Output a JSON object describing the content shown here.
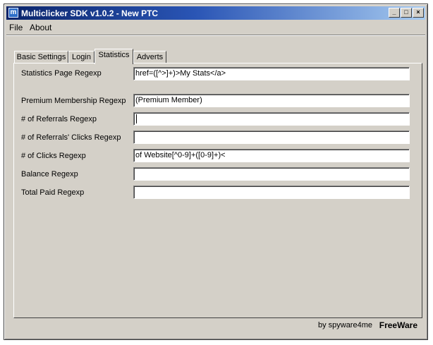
{
  "window": {
    "title": "Multiclicker SDK v1.0.2 - New PTC",
    "app_icon_letter": "m"
  },
  "menu": {
    "items": [
      "File",
      "About"
    ]
  },
  "tabs": [
    {
      "label": "Basic Settings",
      "active": false
    },
    {
      "label": "Login",
      "active": false
    },
    {
      "label": "Statistics",
      "active": true
    },
    {
      "label": "Adverts",
      "active": false
    }
  ],
  "fields": [
    {
      "label": "Statistics Page Regexp",
      "value": "href=([^>]+)>My Stats</a>"
    },
    {
      "label": "Premium Membership Regexp",
      "value": "(Premium Member)"
    },
    {
      "label": "# of Referrals Regexp",
      "value": ""
    },
    {
      "label": "# of Referrals' Clicks Regexp",
      "value": ""
    },
    {
      "label": "# of Clicks Regexp",
      "value": "of Website[^0-9]+([0-9]+)<"
    },
    {
      "label": "Balance Regexp",
      "value": ""
    },
    {
      "label": "Total Paid Regexp",
      "value": ""
    }
  ],
  "footer": {
    "by": "by spyware4me",
    "license": "FreeWare"
  },
  "colors": {
    "titlebar_start": "#0a246a",
    "titlebar_end": "#a6caf0",
    "face": "#d4d0c8"
  }
}
